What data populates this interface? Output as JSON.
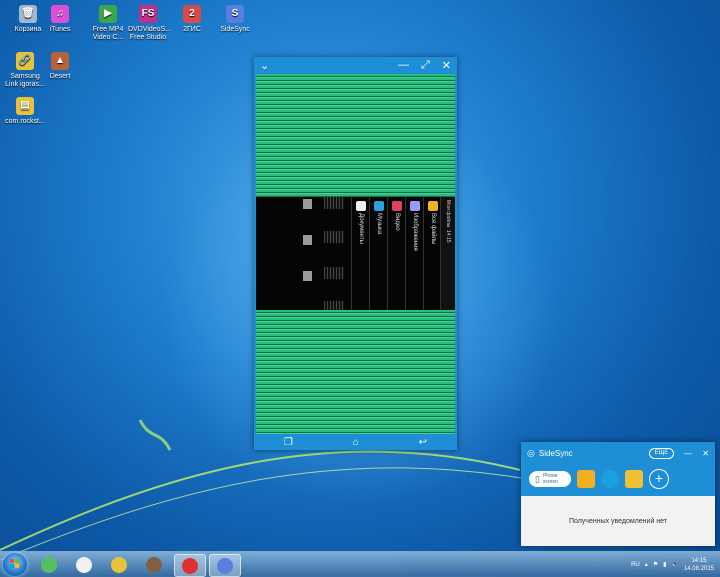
{
  "desktop": {
    "icons": [
      {
        "label": "Корзина",
        "icon": "recycle-bin-icon",
        "color": "#9fb7cf",
        "glyph": "🗑"
      },
      {
        "label": "iTunes",
        "icon": "itunes-icon",
        "color": "#d94fd6",
        "glyph": "♫"
      },
      {
        "label": "Free MP4 Video C...",
        "icon": "mp4-converter-icon",
        "color": "#3aa84a",
        "glyph": "▶"
      },
      {
        "label": "DVDVideoS... Free Studio",
        "icon": "free-studio-icon",
        "color": "#c0308a",
        "glyph": "FS"
      },
      {
        "label": "2ГИС",
        "icon": "2gis-icon",
        "color": "#d84a4a",
        "glyph": "2"
      },
      {
        "label": "SideSync",
        "icon": "sidesync-icon",
        "color": "#5a7ee0",
        "glyph": "S"
      },
      {
        "label": "Samsung Link igoras...",
        "icon": "samsung-link-icon",
        "color": "#e8c23a",
        "glyph": "🔗"
      },
      {
        "label": "Desert",
        "icon": "desert-image-icon",
        "color": "#b8623a",
        "glyph": "▲"
      },
      {
        "label": "com.rockst...",
        "icon": "folder-icon",
        "color": "#e8c23a",
        "glyph": "▤"
      }
    ]
  },
  "phone_window": {
    "title_icons": [
      "chevron-down-icon",
      "minimize-icon",
      "fullscreen-icon",
      "close-icon"
    ],
    "gallery_labels": [
      "Документы",
      "Музыка",
      "Видео",
      "Изображения",
      "Все файлы"
    ],
    "gallery_colors": [
      "#f0f0f0",
      "#2aa0e0",
      "#e04060",
      "#9a9aff",
      "#f0b020"
    ],
    "status_texts": [
      "Мои файлы",
      "14:15"
    ],
    "nav_icons": [
      "recent-apps-icon",
      "home-icon",
      "back-icon"
    ]
  },
  "notification": {
    "title": "SideSync",
    "more_label": "ЕЩЕ",
    "phone_screen_label": "Phone screen",
    "empty_text": "Полученных уведомлений нет"
  },
  "taskbar": {
    "tray_lang": "RU",
    "clock_time": "14:15",
    "clock_date": "14.08.2015",
    "items": [
      {
        "icon": "sims-icon",
        "color": "#55c060",
        "active": false
      },
      {
        "icon": "windows-media-player-icon",
        "color": "#f0f0f0",
        "active": false
      },
      {
        "icon": "file-explorer-icon",
        "color": "#e8c23a",
        "active": false
      },
      {
        "icon": "game-character-icon",
        "color": "#806040",
        "active": false
      },
      {
        "icon": "yandex-browser-icon",
        "color": "#e03030",
        "active": true
      },
      {
        "icon": "sidesync-icon",
        "color": "#5a7ee0",
        "active": true
      }
    ]
  }
}
